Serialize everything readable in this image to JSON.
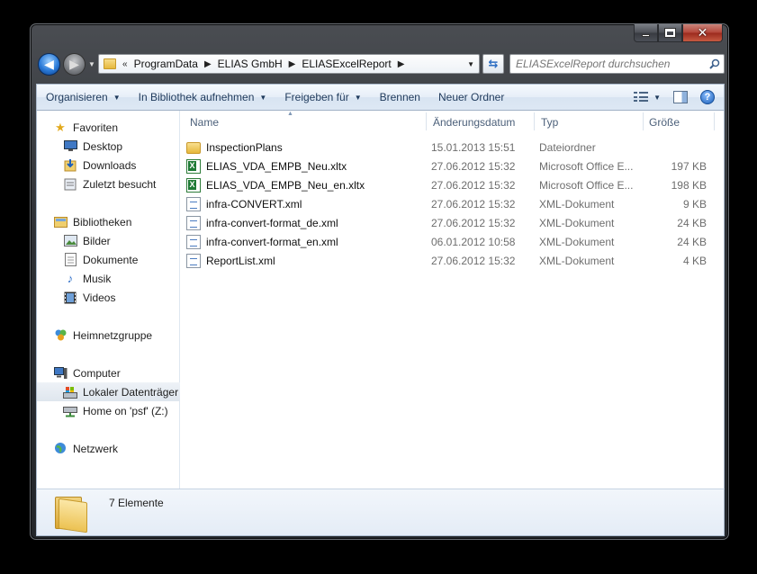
{
  "address": {
    "prefix": "«",
    "crumbs": [
      "ProgramData",
      "ELIAS GmbH",
      "ELIASExcelReport"
    ]
  },
  "search": {
    "placeholder": "ELIASExcelReport durchsuchen"
  },
  "toolbar": {
    "organize": "Organisieren",
    "library": "In Bibliothek aufnehmen",
    "share": "Freigeben für",
    "burn": "Brennen",
    "new_folder": "Neuer Ordner"
  },
  "nav": {
    "favorites": "Favoriten",
    "desktop": "Desktop",
    "downloads": "Downloads",
    "recent": "Zuletzt besucht",
    "libraries": "Bibliotheken",
    "pictures": "Bilder",
    "documents": "Dokumente",
    "music": "Musik",
    "videos": "Videos",
    "homegroup": "Heimnetzgruppe",
    "computer": "Computer",
    "local_disk": "Lokaler Datenträger",
    "home": "Home on 'psf' (Z:)",
    "network": "Netzwerk"
  },
  "columns": {
    "name": "Name",
    "date": "Änderungsdatum",
    "type": "Typ",
    "size": "Größe"
  },
  "files": [
    {
      "name": "InspectionPlans",
      "date": "15.01.2013 15:51",
      "type": "Dateiordner",
      "size": "",
      "icon": "folder-icon"
    },
    {
      "name": "ELIAS_VDA_EMPB_Neu.xltx",
      "date": "27.06.2012 15:32",
      "type": "Microsoft Office E...",
      "size": "197 KB",
      "icon": "excel-file-icon"
    },
    {
      "name": "ELIAS_VDA_EMPB_Neu_en.xltx",
      "date": "27.06.2012 15:32",
      "type": "Microsoft Office E...",
      "size": "198 KB",
      "icon": "excel-file-icon"
    },
    {
      "name": "infra-CONVERT.xml",
      "date": "27.06.2012 15:32",
      "type": "XML-Dokument",
      "size": "9 KB",
      "icon": "xml-file-icon"
    },
    {
      "name": "infra-convert-format_de.xml",
      "date": "27.06.2012 15:32",
      "type": "XML-Dokument",
      "size": "24 KB",
      "icon": "xml-file-icon"
    },
    {
      "name": "infra-convert-format_en.xml",
      "date": "06.01.2012 10:58",
      "type": "XML-Dokument",
      "size": "24 KB",
      "icon": "xml-file-icon"
    },
    {
      "name": "ReportList.xml",
      "date": "27.06.2012 15:32",
      "type": "XML-Dokument",
      "size": "4 KB",
      "icon": "xml-file-icon"
    }
  ],
  "details": {
    "count": "7 Elemente"
  }
}
